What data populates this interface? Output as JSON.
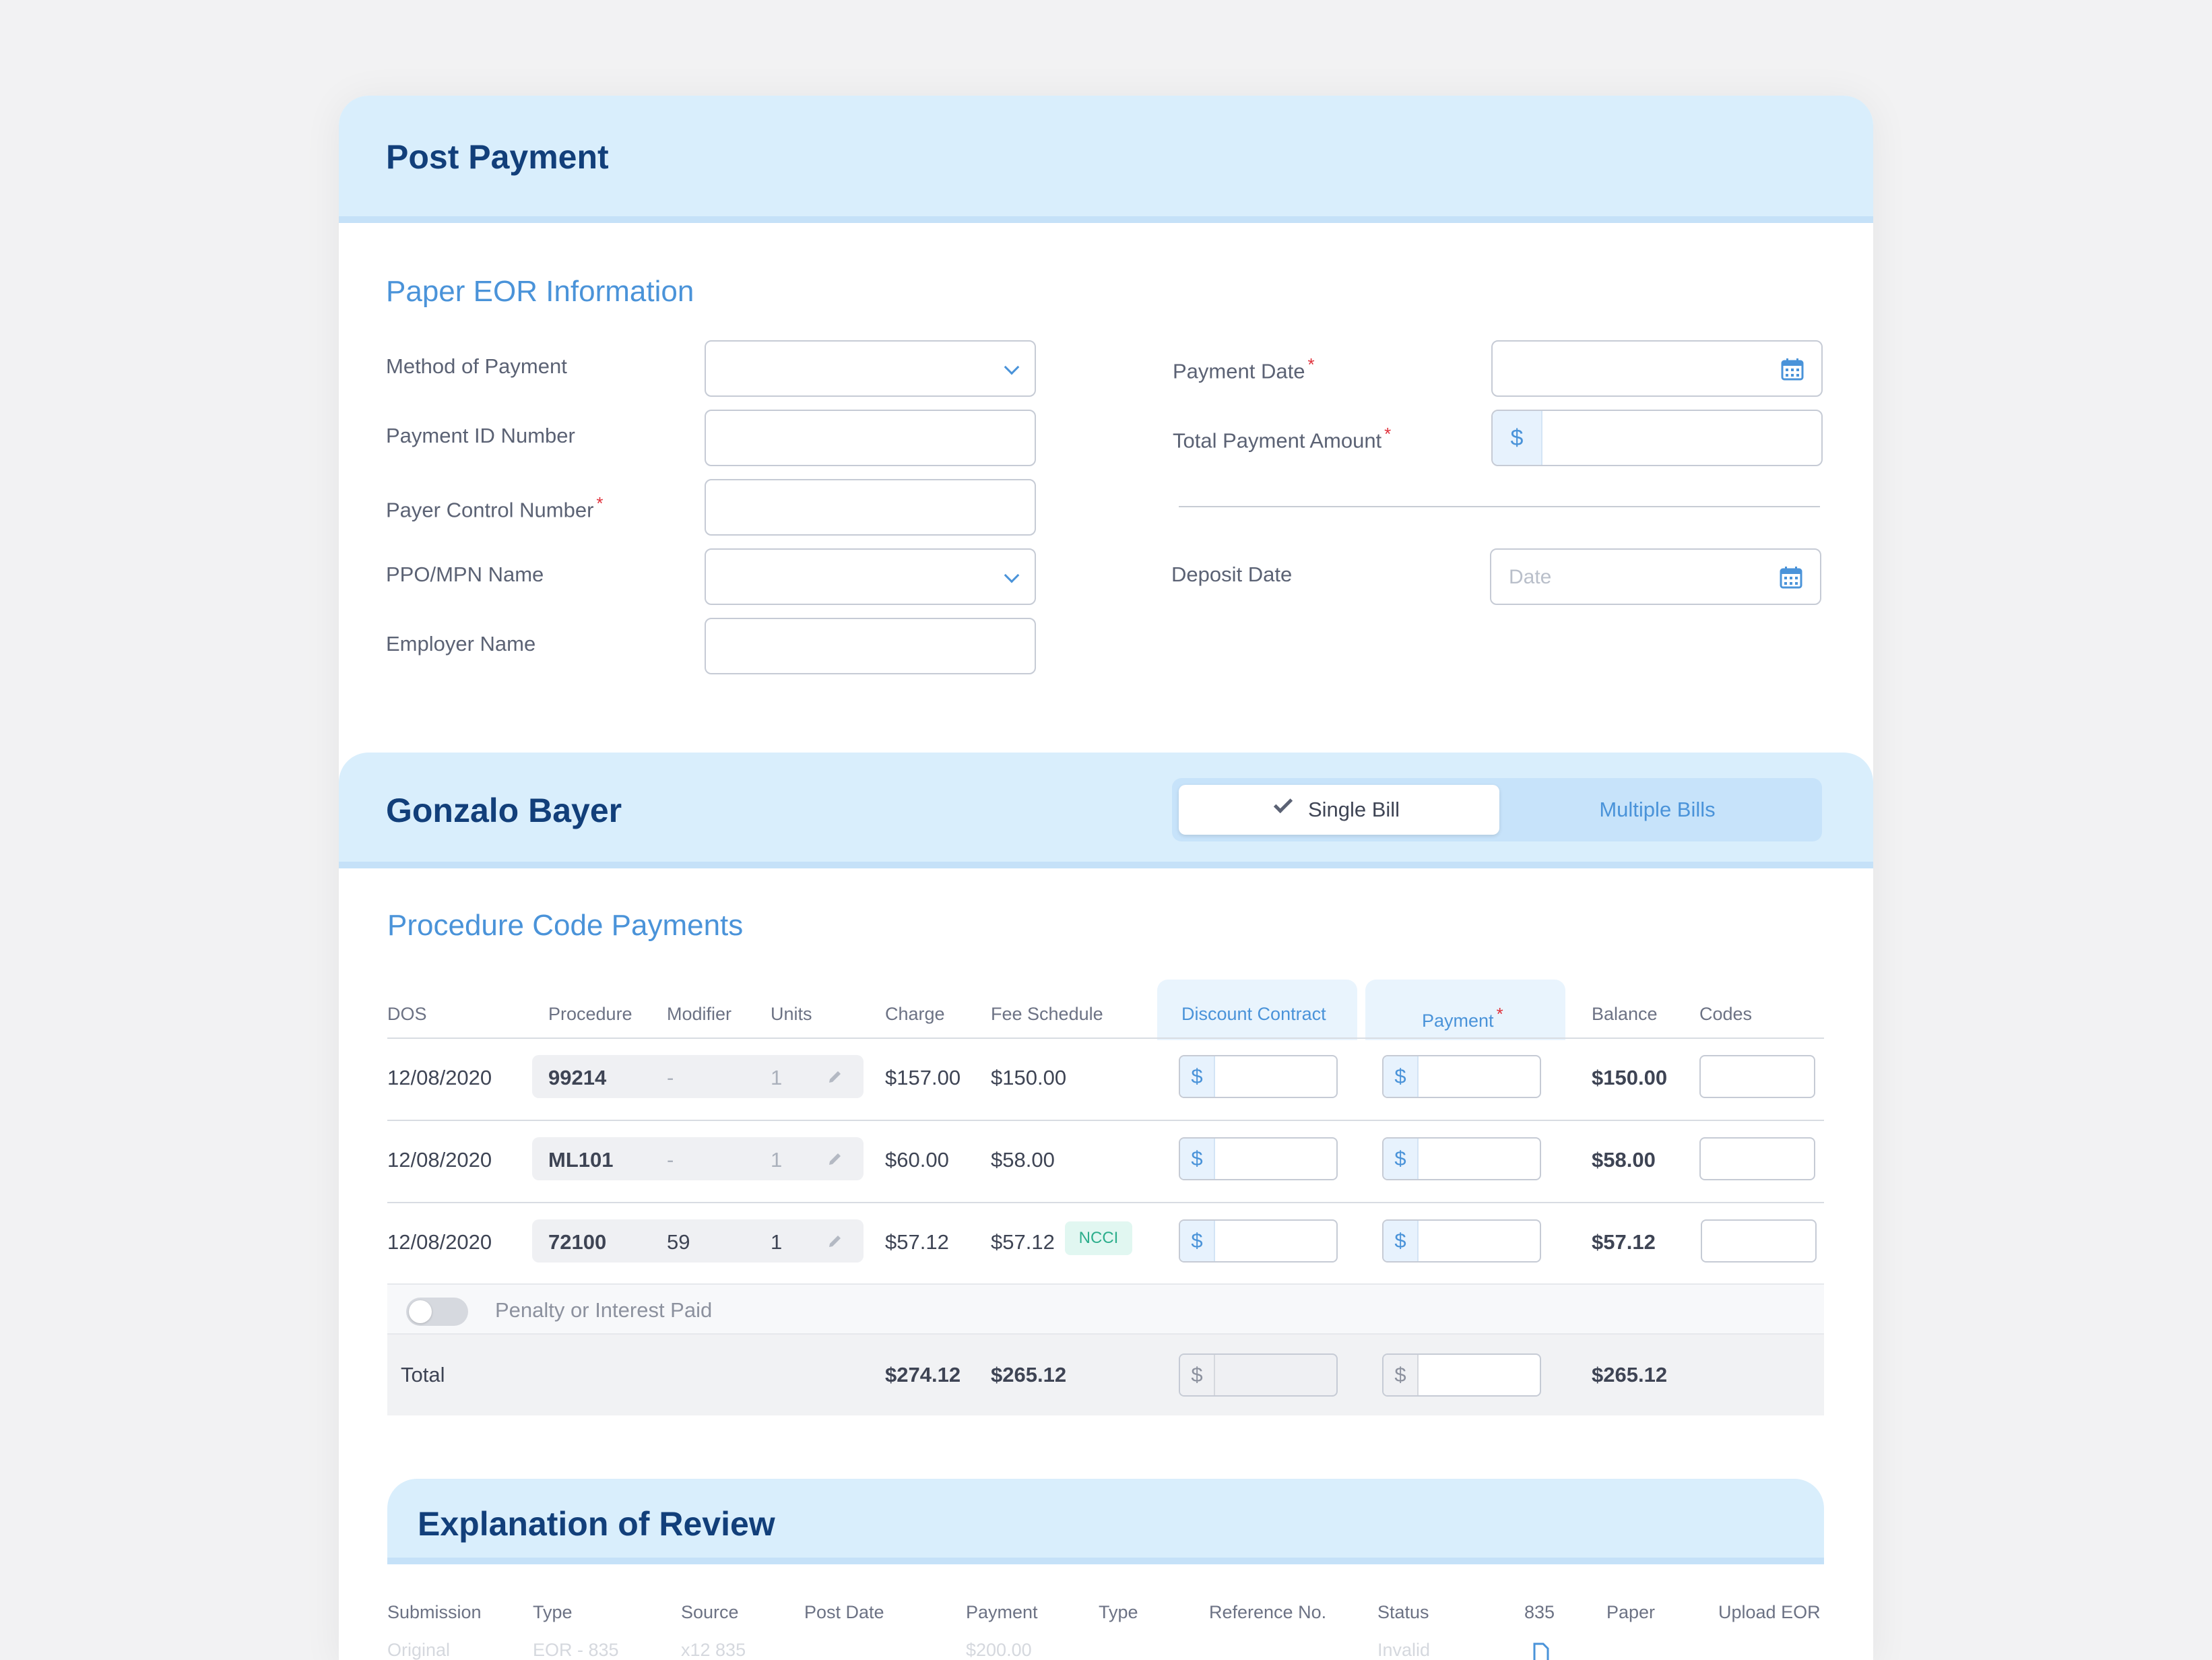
{
  "header": {
    "title": "Post Payment"
  },
  "paper_eor": {
    "title": "Paper EOR Information",
    "labels": {
      "method_of_payment": "Method of Payment",
      "payment_id_number": "Payment ID Number",
      "payer_control_number": "Payer Control Number",
      "ppo_mpn_name": "PPO/MPN Name",
      "employer_name": "Employer Name",
      "payment_date": "Payment Date",
      "total_payment_amount": "Total Payment Amount",
      "deposit_date": "Deposit Date"
    },
    "required_mark": "*",
    "currency_symbol": "$",
    "deposit_date_placeholder": "Date"
  },
  "patient": {
    "name": "Gonzalo Bayer",
    "bill_toggle": {
      "single": "Single Bill",
      "multiple": "Multiple Bills",
      "selected": "Single Bill"
    }
  },
  "procedures": {
    "title": "Procedure Code Payments",
    "columns": {
      "dos": "DOS",
      "procedure": "Procedure",
      "modifier": "Modifier",
      "units": "Units",
      "charge": "Charge",
      "fee_schedule": "Fee Schedule",
      "discount_contract": "Discount Contract",
      "payment": "Payment",
      "balance": "Balance",
      "codes": "Codes"
    },
    "rows": [
      {
        "dos": "12/08/2020",
        "procedure": "99214",
        "modifier": "-",
        "units": "1",
        "charge": "$157.00",
        "fee_schedule": "$150.00",
        "badge": "",
        "balance": "$150.00"
      },
      {
        "dos": "12/08/2020",
        "procedure": "ML101",
        "modifier": "-",
        "units": "1",
        "charge": "$60.00",
        "fee_schedule": "$58.00",
        "badge": "",
        "balance": "$58.00"
      },
      {
        "dos": "12/08/2020",
        "procedure": "72100",
        "modifier": "59",
        "units": "1",
        "charge": "$57.12",
        "fee_schedule": "$57.12",
        "badge": "NCCI",
        "balance": "$57.12"
      }
    ],
    "penalty_label": "Penalty or Interest Paid",
    "penalty_enabled": false,
    "total": {
      "label": "Total",
      "charge": "$274.12",
      "fee_schedule": "$265.12",
      "balance": "$265.12"
    }
  },
  "eor": {
    "title": "Explanation of Review",
    "columns": [
      "Submission",
      "Type",
      "Source",
      "Post Date",
      "Payment",
      "Type",
      "Reference No.",
      "Status",
      "835",
      "Paper",
      "Upload EOR"
    ],
    "first_row": {
      "submission": "Original",
      "type": "EOR - 835",
      "source": "x12 835",
      "payment": "$200.00",
      "status": "Invalid"
    }
  },
  "colors": {
    "accent": "#4a93d9",
    "header_band": "#d9eefc",
    "title_dark": "#123f7a",
    "required": "#e0323c",
    "badge_green": "#2cae8c"
  },
  "icons": {
    "select": "chevron-down-icon",
    "date": "calendar-icon",
    "edit": "pencil-icon",
    "selected": "checkmark-icon",
    "file": "document-icon"
  }
}
